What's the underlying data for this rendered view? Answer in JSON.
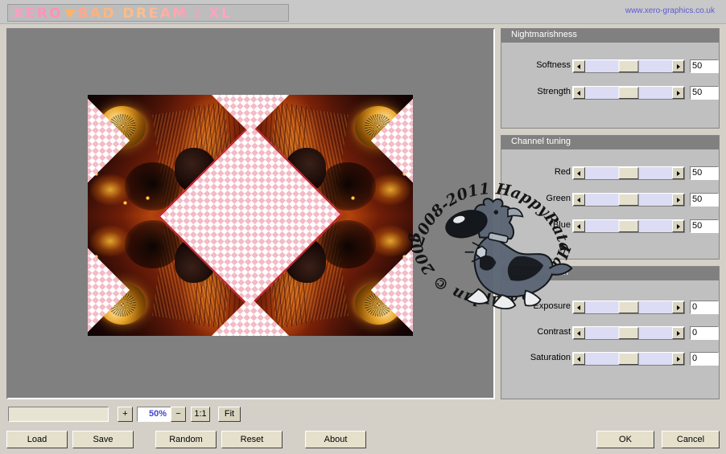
{
  "window": {
    "title_part1": "XERO",
    "title_part2": "BAD DREAM / XL",
    "site_url": "www.xero-graphics.co.uk",
    "title_gradient_from": "#ff9ec4",
    "title_gradient_to": "#ffb27a",
    "triangle_color": "#ffb268"
  },
  "preview": {
    "canvas_bg": "#808080",
    "checker_color": "#f3b9c4"
  },
  "watermark": {
    "text_top": "2008-2011  HappyRataplan",
    "text_bottom": "HappyRataplan © 2008-2011"
  },
  "groups": [
    {
      "name": "nightmarishness",
      "title": "Nightmarishness",
      "sliders": [
        {
          "label": "Softness",
          "value": "50"
        },
        {
          "label": "Strength",
          "value": "50"
        }
      ]
    },
    {
      "name": "channel-tuning",
      "title": "Channel tuning",
      "sliders": [
        {
          "label": "Red",
          "value": "50"
        },
        {
          "label": "Green",
          "value": "50"
        },
        {
          "label": "Blue",
          "value": "50"
        }
      ]
    },
    {
      "name": "compensation",
      "title": "Compensation",
      "sliders": [
        {
          "label": "Exposure",
          "value": "0"
        },
        {
          "label": "Contrast",
          "value": "0"
        },
        {
          "label": "Saturation",
          "value": "0"
        }
      ]
    }
  ],
  "zoom_toolbar": {
    "plus_label": "+",
    "level": "50%",
    "minus_label": "−",
    "one_to_one_label": "1:1",
    "fit_label": "Fit",
    "level_color": "#4444cc"
  },
  "buttons": {
    "load": "Load",
    "save": "Save",
    "random": "Random",
    "reset": "Reset",
    "about": "About",
    "ok": "OK",
    "cancel": "Cancel"
  }
}
